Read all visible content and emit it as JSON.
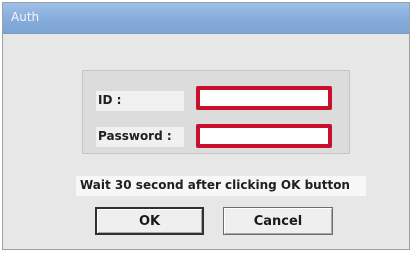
{
  "window": {
    "title": "Auth"
  },
  "form": {
    "id_label": "ID :",
    "id_value": "",
    "password_label": "Password :",
    "password_value": ""
  },
  "hint": "Wait 30 second after clicking OK button",
  "buttons": {
    "ok": "OK",
    "cancel": "Cancel"
  },
  "colors": {
    "field_border": "#c8102e",
    "titlebar": "#86acdb"
  }
}
